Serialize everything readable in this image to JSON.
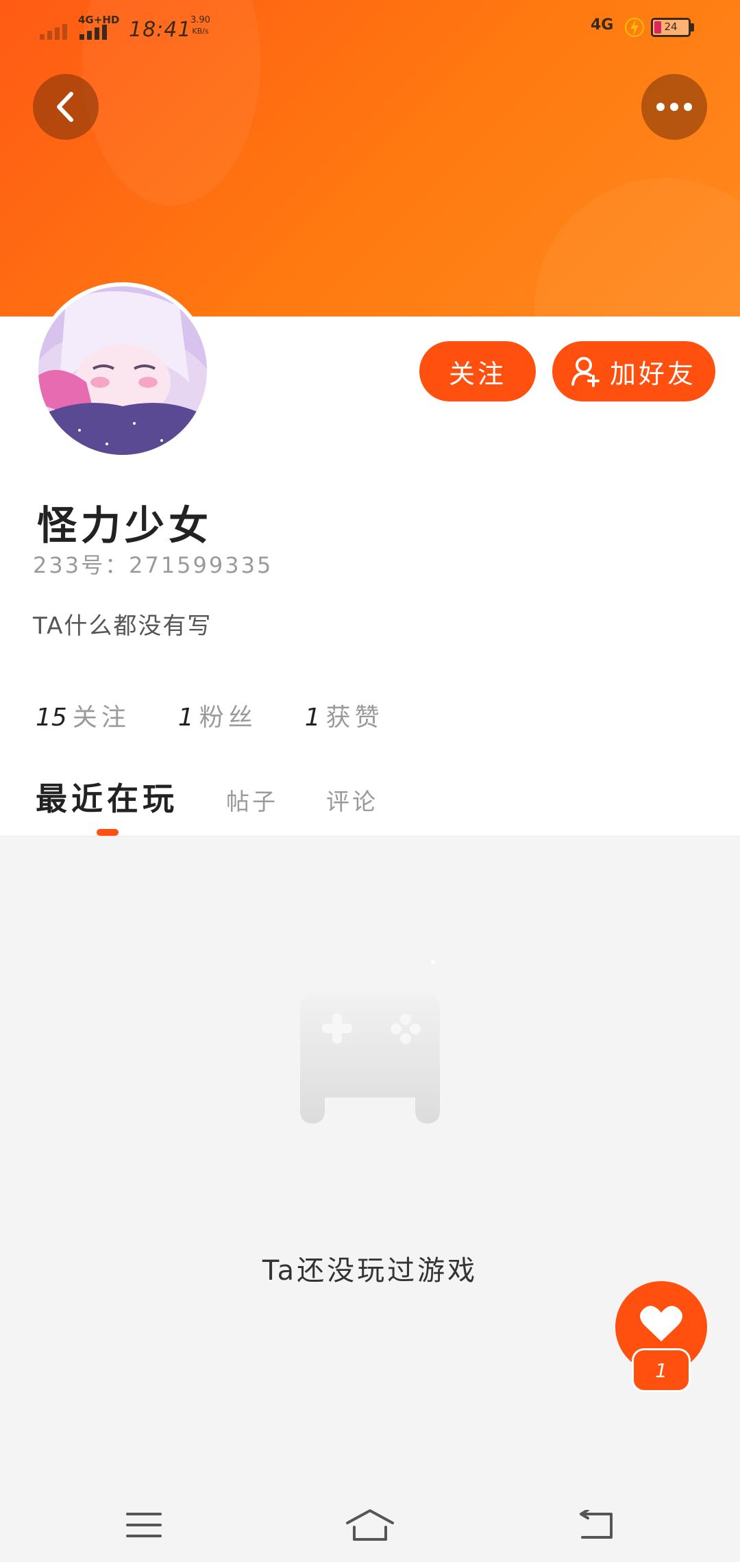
{
  "status_bar": {
    "network_left": "4G+HD",
    "time": "18:41",
    "speed_value": "3.90",
    "speed_unit": "KB/s",
    "network_right": "4G",
    "battery": "24"
  },
  "header": {
    "back_icon": "chevron-left-icon",
    "more_icon": "more-horizontal-icon"
  },
  "profile": {
    "name": "怪力少女",
    "uid": "233号：271599335",
    "bio": "TA什么都没有写",
    "follow_button": "关注",
    "add_friend_button": "加好友"
  },
  "stats": [
    {
      "count": "15",
      "label": "关注"
    },
    {
      "count": "1",
      "label": "粉丝"
    },
    {
      "count": "1",
      "label": "获赞"
    }
  ],
  "tabs": [
    {
      "label": "最近在玩",
      "active": true
    },
    {
      "label": "帖子",
      "active": false
    },
    {
      "label": "评论",
      "active": false
    }
  ],
  "empty_state": {
    "icon": "gamepad-icon",
    "text": "Ta还没玩过游戏"
  },
  "like_fab": {
    "icon": "heart-icon",
    "count": "1"
  },
  "nav_bar": {
    "menu_icon": "menu-icon",
    "home_icon": "home-icon",
    "back_icon": "back-icon"
  },
  "colors": {
    "accent": "#ff5010",
    "banner": "#ff7a10",
    "content_bg": "#f4f4f4"
  }
}
